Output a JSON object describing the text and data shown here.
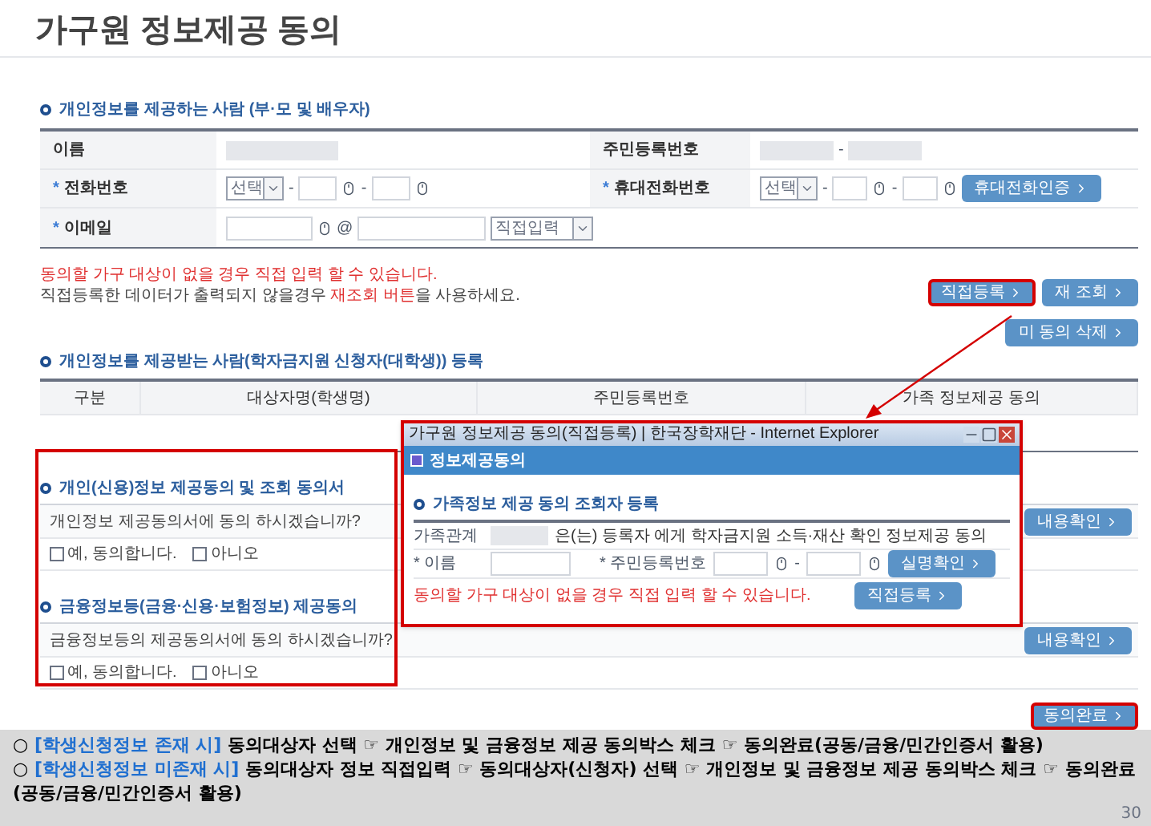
{
  "title": "가구원 정보제공 동의",
  "provider": {
    "heading": "개인정보를 제공하는 사람 (부·모 및 배우자)",
    "name_label": {
      "text": "이름"
    },
    "rrn_label": {
      "text": "주민등록번호"
    },
    "rrn_separator": "-",
    "phone_label": {
      "mark": "*",
      "text": "전화번호"
    },
    "phone_select": "선택",
    "mobile_label": {
      "mark": "*",
      "text": "휴대전화번호"
    },
    "mobile_select": "선택",
    "mobile_button": "휴대전화인증",
    "email_label": {
      "mark": "*",
      "text": "이메일"
    },
    "email_at": "@",
    "email_select": "직접입력",
    "dash": "-"
  },
  "notes": [
    {
      "parts": [
        {
          "text": "동의할 가구 대상이 없을 경우 직접 입력 할 수 있습니다.",
          "highlight": true
        }
      ]
    },
    {
      "parts": [
        {
          "text": "직접등록한 데이터가 출력되지 않을경우 ",
          "highlight": false
        },
        {
          "text": "재조회 버튼",
          "highlight": true
        },
        {
          "text": "을 사용하세요.",
          "highlight": false
        }
      ]
    }
  ],
  "top_buttons": [
    {
      "label": "직접등록",
      "highlighted": true
    },
    {
      "label": "재 조회",
      "highlighted": false
    }
  ],
  "delete_button": "미 동의 삭제",
  "recipient": {
    "heading": "개인정보를 제공받는 사람(학자금지원 신청자(대학생)) 등록",
    "columns": [
      "구분",
      "대상자명(학생명)",
      "주민등록번호",
      "가족 정보제공 동의"
    ]
  },
  "consents": [
    {
      "heading": "개인(신용)정보 제공동의 및 조회 동의서",
      "question": "개인정보 제공동의서에 동의 하시겠습니까?",
      "button": "내용확인",
      "options": [
        {
          "label": "예, 동의합니다.",
          "checked": false
        },
        {
          "label": "아니오",
          "checked": false
        }
      ]
    },
    {
      "heading": "금융정보등(금융·신용·보험정보) 제공동의",
      "question": "금융정보등의 제공동의서에 동의 하시겠습니까?",
      "button": "내용확인",
      "options": [
        {
          "label": "예, 동의합니다.",
          "checked": false
        },
        {
          "label": "아니오",
          "checked": false
        }
      ]
    }
  ],
  "complete_button": "동의완료",
  "popup": {
    "window_title": "가구원 정보제공 동의(직접등록) | 한국장학재단 - Internet Explorer",
    "header": "정보제공동의",
    "heading": "가족정보 제공 동의 조회자 등록",
    "relation_label": "가족관계",
    "relation_text": "은(는) 등록자 에게 학자금지원 소득·재산 확인 정보제공 동의",
    "name_label": "* 이름",
    "rrn_label": "* 주민등록번호",
    "dash": "-",
    "verify_button": "실명확인",
    "note": "동의할 가구 대상이 없을 경우 직접 입력 할 수 있습니다.",
    "register_button": "직접등록"
  },
  "footer": [
    {
      "bullet": "○",
      "tag": "[학생신청정보 존재 시]",
      "text": " 동의대상자 선택 ☞ 개인정보 및 금융정보 제공 동의박스 체크 ☞ 동의완료(공동/금융/민간인증서 활용)"
    },
    {
      "bullet": "○",
      "tag": "[학생신청정보 미존재 시]",
      "text": " 동의대상자 정보 직접입력 ☞ 동의대상자(신청자) 선택 ☞ 개인정보 및 금융정보 제공 동의박스 체크 ☞ 동의완료(공동/금융/민간인증서 활용)"
    }
  ],
  "page_number": "30"
}
